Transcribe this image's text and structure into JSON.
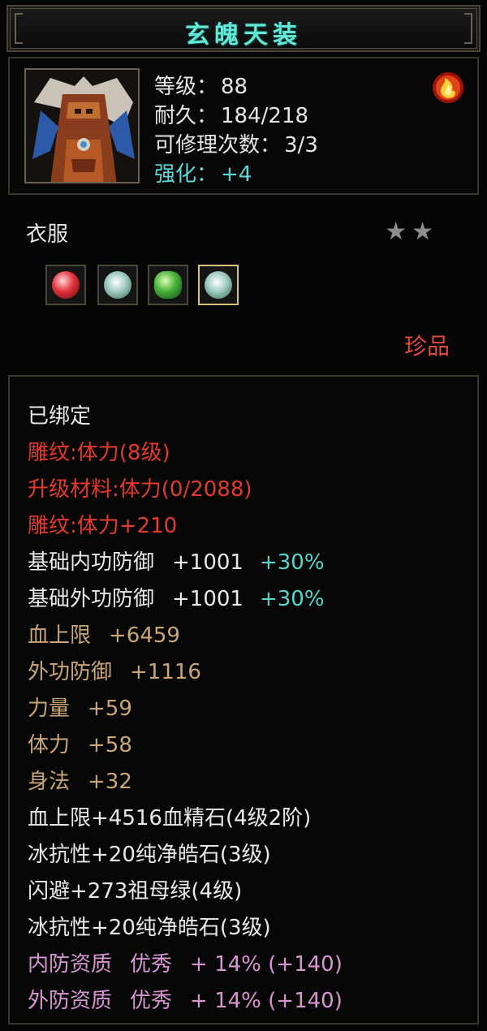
{
  "item": {
    "name": "玄魄天装",
    "level_label": "等级：",
    "level_value": "88",
    "durability_label": "耐久：",
    "durability_value": "184/218",
    "repair_label": "可修理次数：",
    "repair_value": "3/3",
    "enhance_label": "强化：",
    "enhance_value": "+4",
    "type": "衣服",
    "stars": "★★",
    "rarity": "珍品",
    "gems": [
      "blood-gem-icon",
      "diamond-gem-icon",
      "emerald-gem-icon",
      "diamond-gem-icon"
    ]
  },
  "attributes": {
    "bound": "已绑定",
    "engrave": "雕纹:体力(8级)",
    "upgrade_material": "升级材料:体力(0/2088)",
    "engrave_bonus": "雕纹:体力+210",
    "inner_def_name": "基础内功防御",
    "inner_def_value": "+1001",
    "inner_def_pct": "+30%",
    "outer_def_name": "基础外功防御",
    "outer_def_value": "+1001",
    "outer_def_pct": "+30%",
    "hp_name": "血上限",
    "hp_value": "+6459",
    "outer_atk_def_name": "外功防御",
    "outer_atk_def_value": "+1116",
    "strength_name": "力量",
    "strength_value": "+59",
    "vitality_name": "体力",
    "vitality_value": "+58",
    "agility_name": "身法",
    "agility_value": "+32",
    "gem1": "血上限+4516血精石(4级2阶)",
    "gem2": "冰抗性+20纯净皓石(3级)",
    "gem3": "闪避+273祖母绿(4级)",
    "gem4": "冰抗性+20纯净皓石(3级)",
    "quality1_name": "内防资质",
    "quality1_grade": "优秀",
    "quality1_value": "+ 14% (+140)",
    "quality2_name": "外防资质",
    "quality2_grade": "优秀",
    "quality2_value": "+ 14% (+140)"
  },
  "colors": {
    "title": "#63e6d6",
    "red": "#e33a2f",
    "gold": "#c8a678",
    "cyan": "#58d6cc",
    "pink": "#d796d0"
  }
}
